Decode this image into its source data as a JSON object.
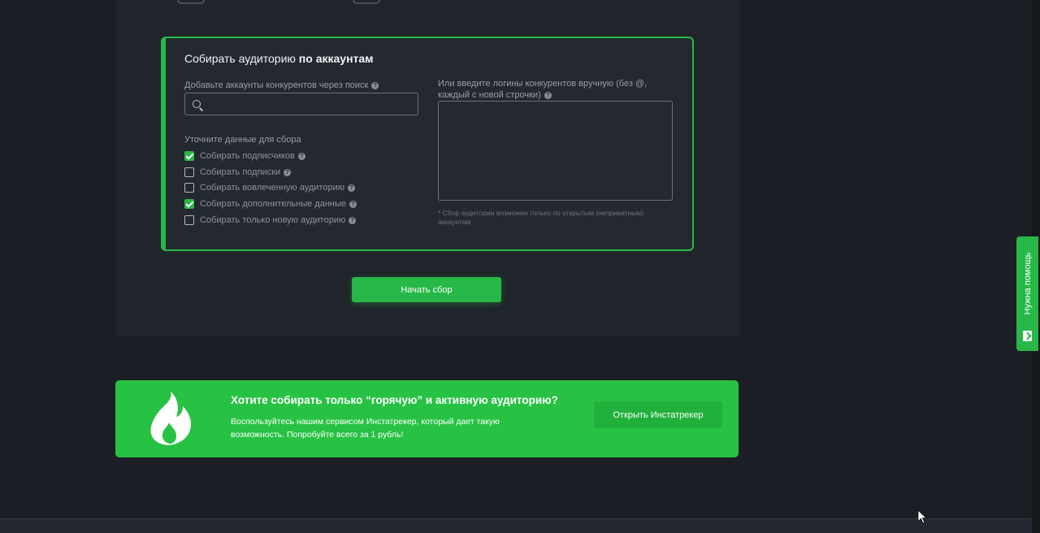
{
  "card": {
    "title_prefix": "Собирать аудиторию ",
    "title_bold": "по аккаунтам",
    "search_label": "Добавьте аккаунты конкурентов через поиск",
    "search_value": "",
    "manual_label": "Или введите логины конкурентов вручную (без @, каждый с новой строчки)",
    "manual_value": "",
    "refine_label": "Уточните данные для сбора",
    "options": [
      {
        "label": "Собирать подписчиков",
        "checked": true
      },
      {
        "label": "Собирать подписки",
        "checked": false
      },
      {
        "label": "Собирать вовлеченную аудиторию",
        "checked": false
      },
      {
        "label": "Собирать дополнительные данные",
        "checked": true
      },
      {
        "label": "Собирать только новую аудиторию",
        "checked": false
      }
    ],
    "footnote": "* Сбор аудитории возможен только по открытым (неприватным) аккаунтам"
  },
  "start_button": "Начать сбор",
  "promo": {
    "title": "Хотите собирать только “горячую” и активную аудиторию?",
    "text": "Воспользуйтесь нашим сервисом Инстатрекер, который дает такую возможность. Попробуйте всего за 1 рубль!",
    "button": "Открыть Инстатрекер"
  },
  "help_tab": "Нужна помощь",
  "colors": {
    "accent": "#27b847",
    "background": "#1b1e24",
    "card": "#242830"
  }
}
